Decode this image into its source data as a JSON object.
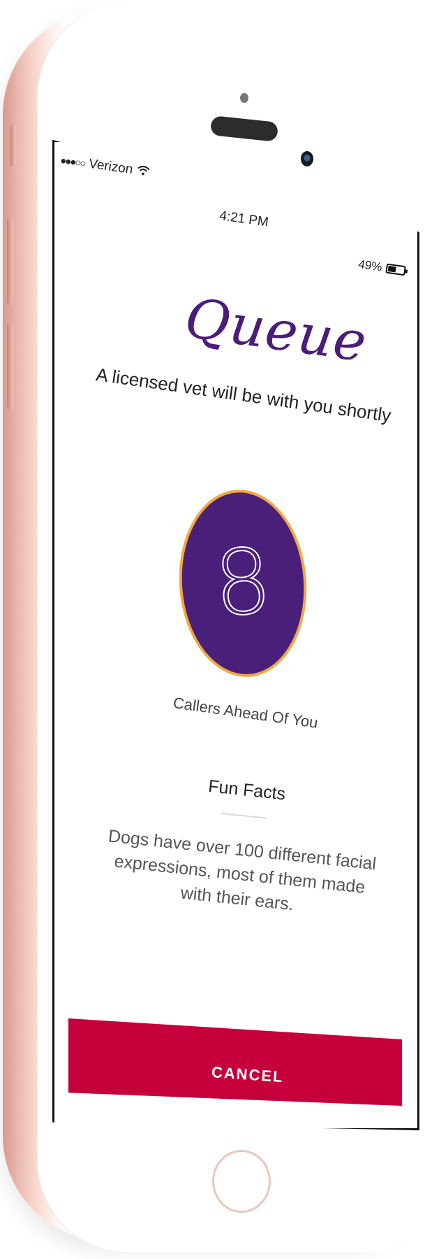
{
  "status_bar": {
    "signal_dots": "●●●○○",
    "carrier": "Verizon",
    "wifi_icon": "wifi-icon",
    "time": "4:21 PM",
    "battery_percent": "49%",
    "battery_level": 0.49
  },
  "header": {
    "logo_text": "Queue",
    "subtitle": "A licensed vet will be with you shortly"
  },
  "queue": {
    "count": "8",
    "label": "Callers Ahead Of You"
  },
  "facts": {
    "title": "Fun Facts",
    "body": "Dogs have over 100 different facial expressions, most of them made with their ears."
  },
  "actions": {
    "cancel_label": "CANCEL"
  },
  "colors": {
    "brand_purple": "#4a1f7a",
    "circle_border": "#f3a843",
    "cancel_red": "#c5003a",
    "phone_rose_gold": "#f4cbc1"
  }
}
